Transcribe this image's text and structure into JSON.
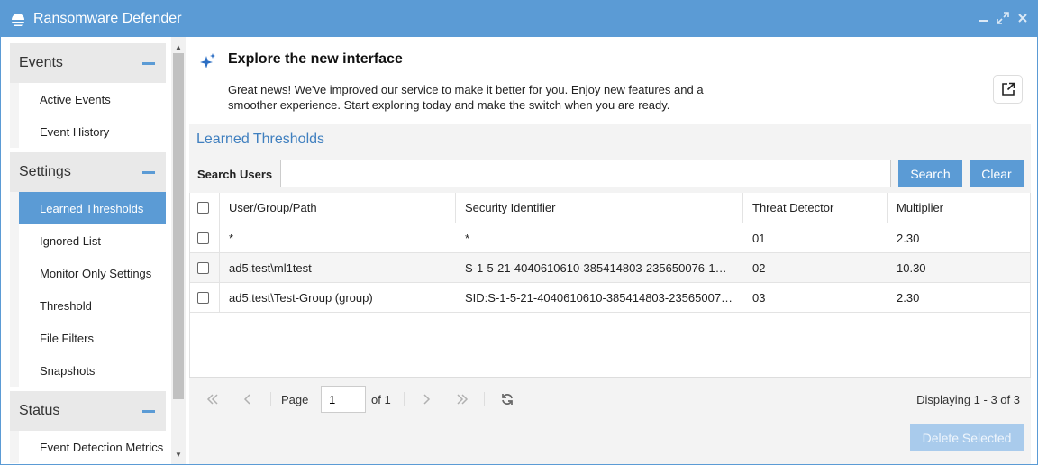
{
  "window": {
    "title": "Ransomware Defender",
    "controls": [
      "minimize-icon",
      "maximize-icon",
      "close-icon"
    ]
  },
  "sidebar": {
    "sections": [
      {
        "title": "Events",
        "items": [
          {
            "label": "Active Events"
          },
          {
            "label": "Event History"
          }
        ]
      },
      {
        "title": "Settings",
        "items": [
          {
            "label": "Learned Thresholds",
            "active": true
          },
          {
            "label": "Ignored List"
          },
          {
            "label": "Monitor Only Settings"
          },
          {
            "label": "Threshold"
          },
          {
            "label": "File Filters"
          },
          {
            "label": "Snapshots"
          }
        ]
      },
      {
        "title": "Status",
        "items": [
          {
            "label": "Event Detection Metrics"
          }
        ]
      }
    ]
  },
  "banner": {
    "title": "Explore the new interface",
    "text": "Great news! We've improved our service to make it better for you. Enjoy new features and a smoother experience. Start exploring today and make the switch when you are ready."
  },
  "panel": {
    "title": "Learned Thresholds",
    "search": {
      "label": "Search Users",
      "value": "",
      "search_button": "Search",
      "clear_button": "Clear"
    },
    "columns": [
      "User/Group/Path",
      "Security Identifier",
      "Threat Detector",
      "Multiplier"
    ],
    "rows": [
      {
        "user": "*",
        "sid": "*",
        "detector": "01",
        "multiplier": "2.30"
      },
      {
        "user": "ad5.test\\ml1test",
        "sid": "S-1-5-21-4040610610-385414803-235650076-1…",
        "detector": "02",
        "multiplier": "10.30"
      },
      {
        "user": "ad5.test\\Test-Group (group)",
        "sid": "SID:S-1-5-21-4040610610-385414803-23565007…",
        "detector": "03",
        "multiplier": "2.30"
      }
    ],
    "pager": {
      "page_label": "Page",
      "page_value": "1",
      "of_label": "of 1",
      "display": "Displaying 1 - 3 of 3"
    },
    "delete_button": "Delete Selected"
  },
  "colors": {
    "accent": "#5b9bd5",
    "title_link": "#3f7fbf",
    "disabled": "#a9cbec"
  }
}
